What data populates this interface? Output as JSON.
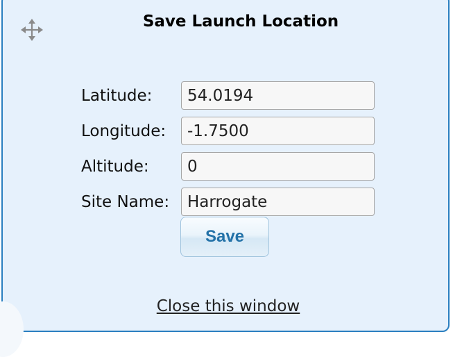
{
  "dialog": {
    "title": "Save Launch Location",
    "move_icon": "move-arrows-icon"
  },
  "form": {
    "latitude": {
      "label": "Latitude:",
      "value": "54.0194"
    },
    "longitude": {
      "label": "Longitude:",
      "value": "-1.7500"
    },
    "altitude": {
      "label": "Altitude:",
      "value": "0"
    },
    "site_name": {
      "label": "Site Name:",
      "value": "Harrogate"
    },
    "save_label": "Save"
  },
  "footer": {
    "close_label": "Close this window"
  },
  "colors": {
    "panel_background": "#e6f1fc",
    "panel_border": "#2a7fc0",
    "save_text": "#2472a8"
  }
}
